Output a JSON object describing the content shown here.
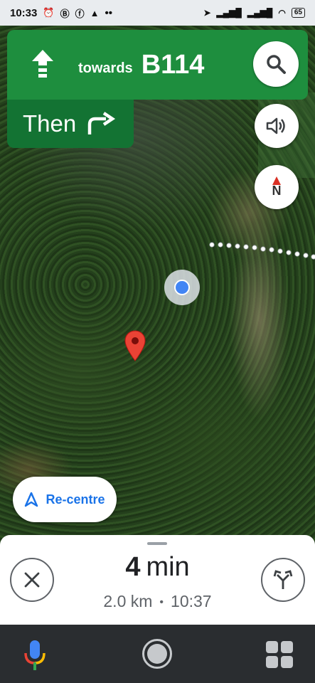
{
  "status_bar": {
    "time": "10:33",
    "left_icons": [
      "alarm-icon",
      "b-badge-icon",
      "facebook-icon",
      "navigation-arrow-icon"
    ],
    "more": "••",
    "battery": "65"
  },
  "navigation": {
    "direction_icon": "straight-arrow-icon",
    "towards_label": "towards",
    "road_name": "B114",
    "then_label": "Then",
    "then_icon": "turn-right-icon",
    "colors": {
      "primary": "#1e8e3e",
      "secondary": "#137333"
    }
  },
  "map_controls": {
    "search_icon": "search-icon",
    "sound_icon": "speaker-icon",
    "compass_label": "N"
  },
  "recentre": {
    "label": "Re-centre"
  },
  "trip": {
    "duration_value": "4",
    "duration_unit": "min",
    "distance": "2.0 km",
    "separator": "•",
    "arrival_time": "10:37"
  },
  "system_nav": {
    "left_icon": "microphone-icon",
    "center_icon": "home-icon",
    "right_icon": "apps-grid-icon"
  }
}
